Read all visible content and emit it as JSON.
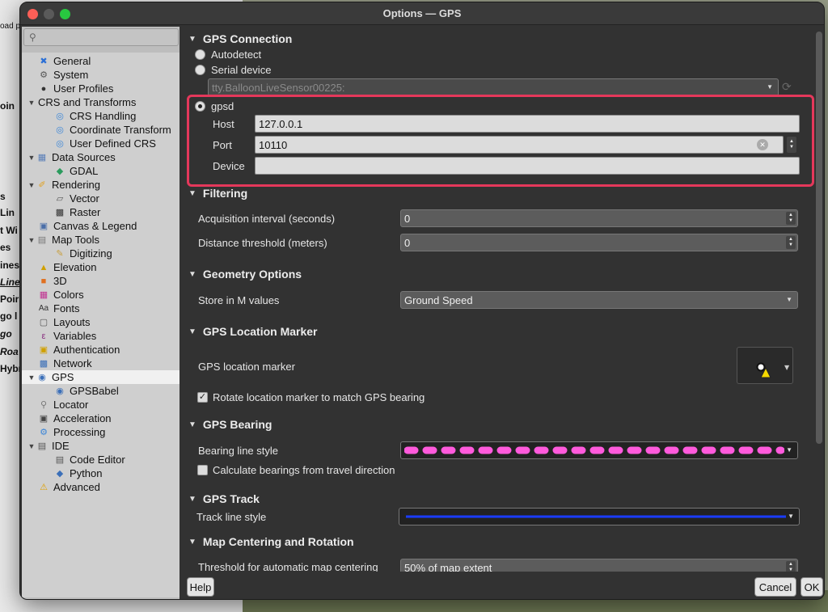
{
  "window": {
    "title": "Options — GPS"
  },
  "background": {
    "labels": [
      "oad p",
      "oin",
      "s",
      "Lin",
      "t Wi",
      "es",
      "ines",
      "Line",
      "Poir",
      "go l",
      "go",
      "Roa",
      "Hybr"
    ]
  },
  "sidebar": {
    "items": [
      {
        "label": "General",
        "icon": "general-icon"
      },
      {
        "label": "System",
        "icon": "system-icon"
      },
      {
        "label": "User Profiles",
        "icon": "user-profiles-icon"
      },
      {
        "label": "CRS and Transforms",
        "icon": ""
      },
      {
        "label": "CRS Handling",
        "icon": "globe-icon"
      },
      {
        "label": "Coordinate Transform",
        "icon": "globe-icon"
      },
      {
        "label": "User Defined CRS",
        "icon": "globe-icon"
      },
      {
        "label": "Data Sources",
        "icon": "data-sources-icon"
      },
      {
        "label": "GDAL",
        "icon": "gdal-icon"
      },
      {
        "label": "Rendering",
        "icon": "rendering-icon"
      },
      {
        "label": "Vector",
        "icon": "vector-icon"
      },
      {
        "label": "Raster",
        "icon": "raster-icon"
      },
      {
        "label": "Canvas & Legend",
        "icon": "canvas-icon"
      },
      {
        "label": "Map Tools",
        "icon": "map-tools-icon"
      },
      {
        "label": "Digitizing",
        "icon": "digitizing-icon"
      },
      {
        "label": "Elevation",
        "icon": "elevation-icon"
      },
      {
        "label": "3D",
        "icon": "3d-icon"
      },
      {
        "label": "Colors",
        "icon": "colors-icon"
      },
      {
        "label": "Fonts",
        "icon": "fonts-icon"
      },
      {
        "label": "Layouts",
        "icon": "layouts-icon"
      },
      {
        "label": "Variables",
        "icon": "variables-icon"
      },
      {
        "label": "Authentication",
        "icon": "lock-icon"
      },
      {
        "label": "Network",
        "icon": "network-icon"
      },
      {
        "label": "GPS",
        "icon": "gps-icon"
      },
      {
        "label": "GPSBabel",
        "icon": "gpsbabel-icon"
      },
      {
        "label": "Locator",
        "icon": "search-icon"
      },
      {
        "label": "Acceleration",
        "icon": "chip-icon"
      },
      {
        "label": "Processing",
        "icon": "gear-icon"
      },
      {
        "label": "IDE",
        "icon": "ide-icon"
      },
      {
        "label": "Code Editor",
        "icon": "code-editor-icon"
      },
      {
        "label": "Python",
        "icon": "python-icon"
      },
      {
        "label": "Advanced",
        "icon": "warning-icon"
      }
    ]
  },
  "gps_connection": {
    "heading": "GPS Connection",
    "autodetect_label": "Autodetect",
    "serial_label": "Serial device",
    "serial_value": "tty.BalloonLiveSensor00225:",
    "gpsd_label": "gpsd",
    "host_label": "Host",
    "host_value": "127.0.0.1",
    "port_label": "Port",
    "port_value": "10110",
    "device_label": "Device",
    "device_value": ""
  },
  "filtering": {
    "heading": "Filtering",
    "acq_label": "Acquisition interval (seconds)",
    "acq_value": "0",
    "dist_label": "Distance threshold (meters)",
    "dist_value": "0"
  },
  "geometry": {
    "heading": "Geometry Options",
    "store_label": "Store in M values",
    "store_value": "Ground Speed"
  },
  "location_marker": {
    "heading": "GPS Location Marker",
    "marker_label": "GPS location marker",
    "rotate_label": "Rotate location marker to match GPS bearing"
  },
  "bearing": {
    "heading": "GPS Bearing",
    "style_label": "Bearing line style",
    "calc_label": "Calculate bearings from travel direction",
    "color": "#ff5adc"
  },
  "track": {
    "heading": "GPS Track",
    "style_label": "Track line style",
    "color": "#1a3cff"
  },
  "centering": {
    "heading": "Map Centering and Rotation",
    "threshold_label": "Threshold for automatic map centering",
    "threshold_value": "50% of map extent"
  },
  "buttons": {
    "help": "Help",
    "cancel": "Cancel",
    "ok": "OK"
  },
  "colors": {
    "highlight": "#e5385b"
  }
}
